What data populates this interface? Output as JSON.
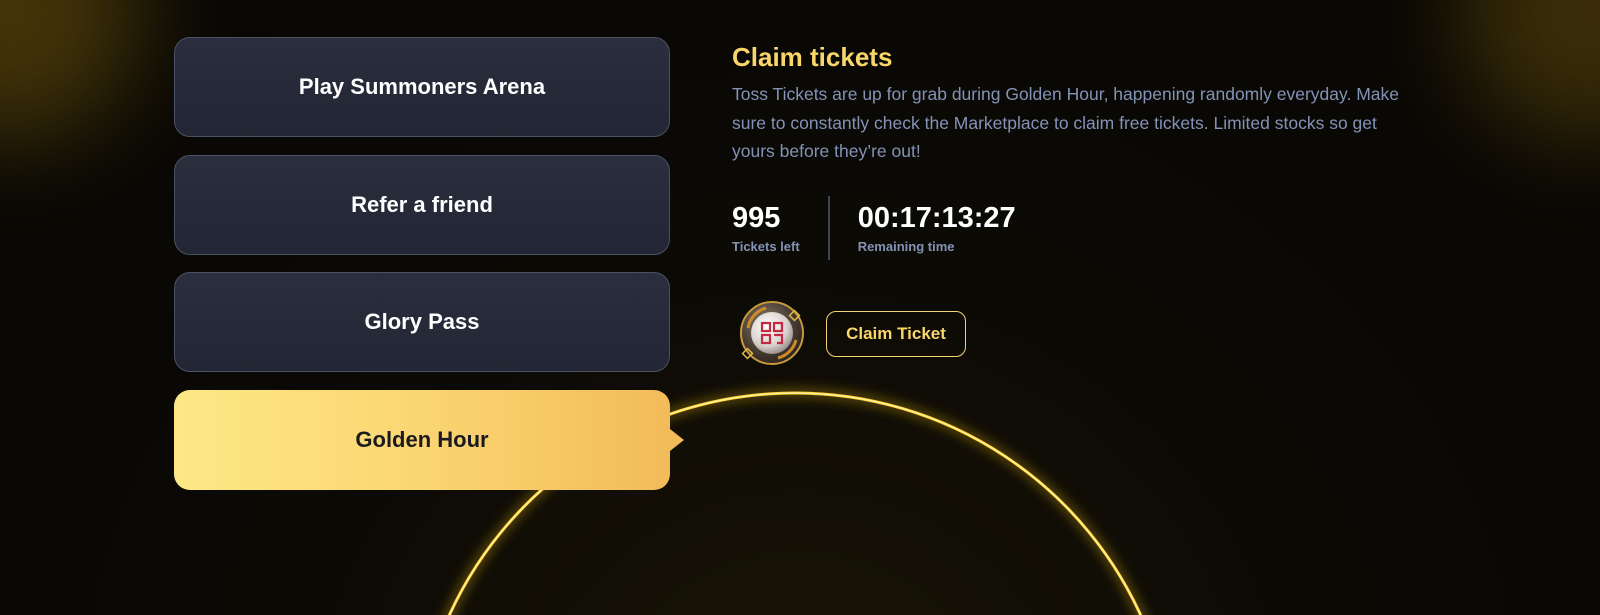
{
  "tabs": [
    {
      "label": "Play Summoners Arena",
      "active": false
    },
    {
      "label": "Refer a friend",
      "active": false
    },
    {
      "label": "Glory Pass",
      "active": false
    },
    {
      "label": "Golden Hour",
      "active": true
    }
  ],
  "panel": {
    "title": "Claim tickets",
    "description": "Toss Tickets are up for grab during Golden Hour, happening randomly everyday. Make sure to constantly check the Marketplace to claim free tickets. Limited stocks so get yours before they’re out!",
    "stats": {
      "tickets_left_value": "995",
      "tickets_left_label": "Tickets left",
      "remaining_time_value": "00:17:13:27",
      "remaining_time_label": "Remaining time"
    },
    "claim_button_label": "Claim Ticket",
    "ticket_icon": "toss-ticket-coin-icon"
  },
  "colors": {
    "accent_gold": "#f9d669",
    "tab_bg": "#262a39",
    "active_tab_gradient_start": "#fde886",
    "active_tab_gradient_end": "#f2bb5a",
    "muted_text": "#8393b6",
    "arc_glow": "#ffd21e"
  }
}
